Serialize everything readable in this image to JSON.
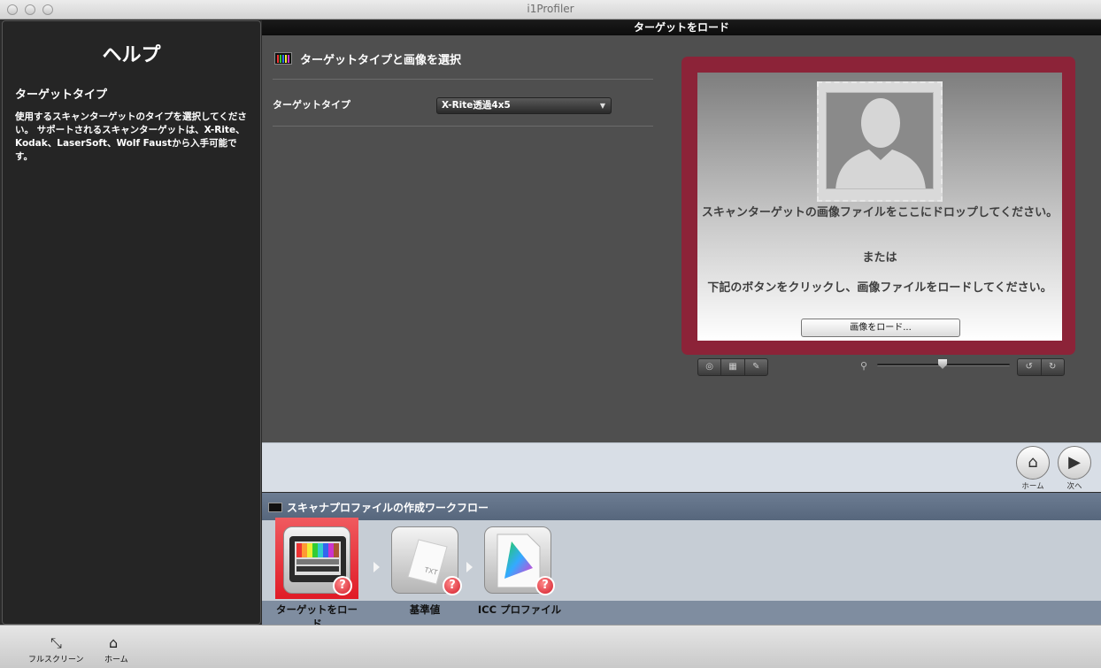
{
  "window": {
    "title": "i1Profiler"
  },
  "help": {
    "title": "ヘルプ",
    "subtitle": "ターゲットタイプ",
    "text": "使用するスキャンターゲットのタイプを選択してください。 サポートされるスキャンターゲットは、X-Rite、Kodak、LaserSoft、Wolf Faustから入手可能です。"
  },
  "main": {
    "header": "ターゲットをロード",
    "section_title": "ターゲットタイプと画像を選択",
    "target_type_label": "ターゲットタイプ",
    "target_type_value": "X-Rite透過4x5",
    "drop_text_1": "スキャンターゲットの画像ファイルをここにドロップしてください。",
    "drop_or": "または",
    "drop_text_2": "下記のボタンをクリックし、画像ファイルをロードしてください。",
    "load_button": "画像をロード...",
    "icons": [
      "target-icon",
      "grid-icon",
      "eyedropper-icon",
      "zoom-icon",
      "rotate-left-icon",
      "rotate-right-icon"
    ]
  },
  "nav": {
    "home_label": "ホーム",
    "next_label": "次へ"
  },
  "workflow": {
    "title": "スキャナプロファイルの作成ワークフロー",
    "steps": [
      {
        "label": "ターゲットをロード",
        "icon": "target-chart-icon",
        "active": true
      },
      {
        "label": "基準値",
        "icon": "txt-document-icon",
        "active": false
      },
      {
        "label": "ICC プロファイル",
        "icon": "icc-profile-icon",
        "active": false
      }
    ]
  },
  "bottom": {
    "fullscreen_label": "フルスクリーン",
    "home_label": "ホーム"
  },
  "colors": {
    "accent": "#8c2338",
    "active_step": "#e01b26",
    "workflow_header": "#5f6f85"
  }
}
